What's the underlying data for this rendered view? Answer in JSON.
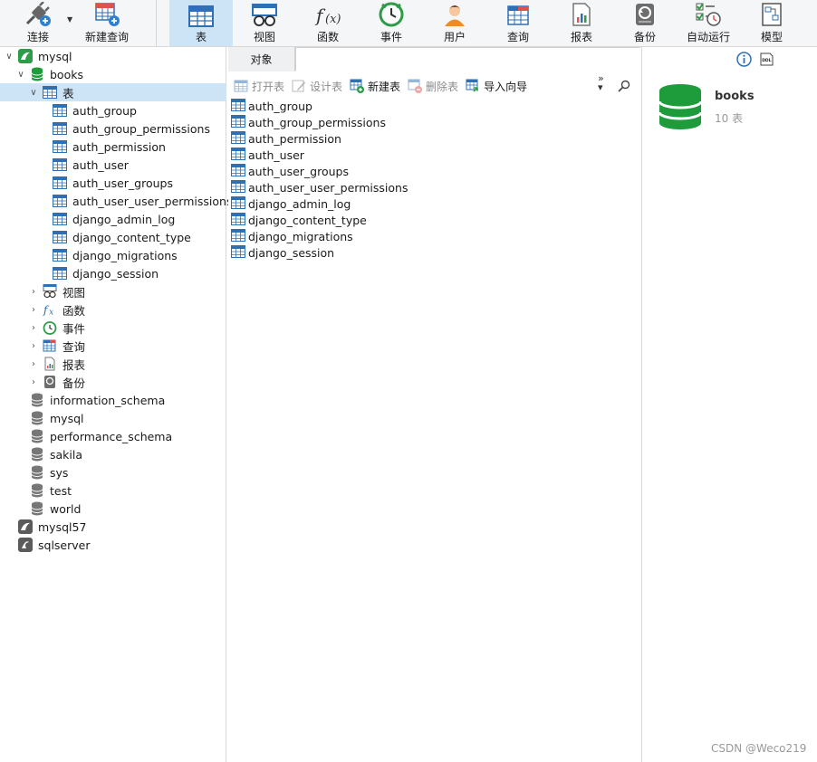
{
  "toolbar": {
    "connect": "连接",
    "new_query": "新建查询",
    "table": "表",
    "view": "视图",
    "function": "函数",
    "event": "事件",
    "user": "用户",
    "query": "查询",
    "report": "报表",
    "backup": "备份",
    "automation": "自动运行",
    "model": "模型"
  },
  "tree": {
    "conn_mysql": "mysql",
    "db_books": "books",
    "folder_tables": "表",
    "tables": [
      "auth_group",
      "auth_group_permissions",
      "auth_permission",
      "auth_user",
      "auth_user_groups",
      "auth_user_user_permissions",
      "django_admin_log",
      "django_content_type",
      "django_migrations",
      "django_session"
    ],
    "folder_views": "视图",
    "folder_functions": "函数",
    "folder_events": "事件",
    "folder_queries": "查询",
    "folder_reports": "报表",
    "folder_backups": "备份",
    "databases": [
      "information_schema",
      "mysql",
      "performance_schema",
      "sakila",
      "sys",
      "test",
      "world"
    ],
    "conn_mysql57": "mysql57",
    "conn_sqlserver": "sqlserver"
  },
  "middle": {
    "tab_objects": "对象",
    "tools": {
      "open_table": "打开表",
      "design_table": "设计表",
      "new_table": "新建表",
      "delete_table": "删除表",
      "import_wizard": "导入向导"
    },
    "more": "»",
    "objects": [
      "auth_group",
      "auth_group_permissions",
      "auth_permission",
      "auth_user",
      "auth_user_groups",
      "auth_user_user_permissions",
      "django_admin_log",
      "django_content_type",
      "django_migrations",
      "django_session"
    ]
  },
  "right": {
    "db_name": "books",
    "table_count": "10 表"
  },
  "watermark": "CSDN @Weco219",
  "colors": {
    "accent": "#cde3f6",
    "db_green": "#1e9b3a",
    "table_blue": "#2f6fb3"
  }
}
